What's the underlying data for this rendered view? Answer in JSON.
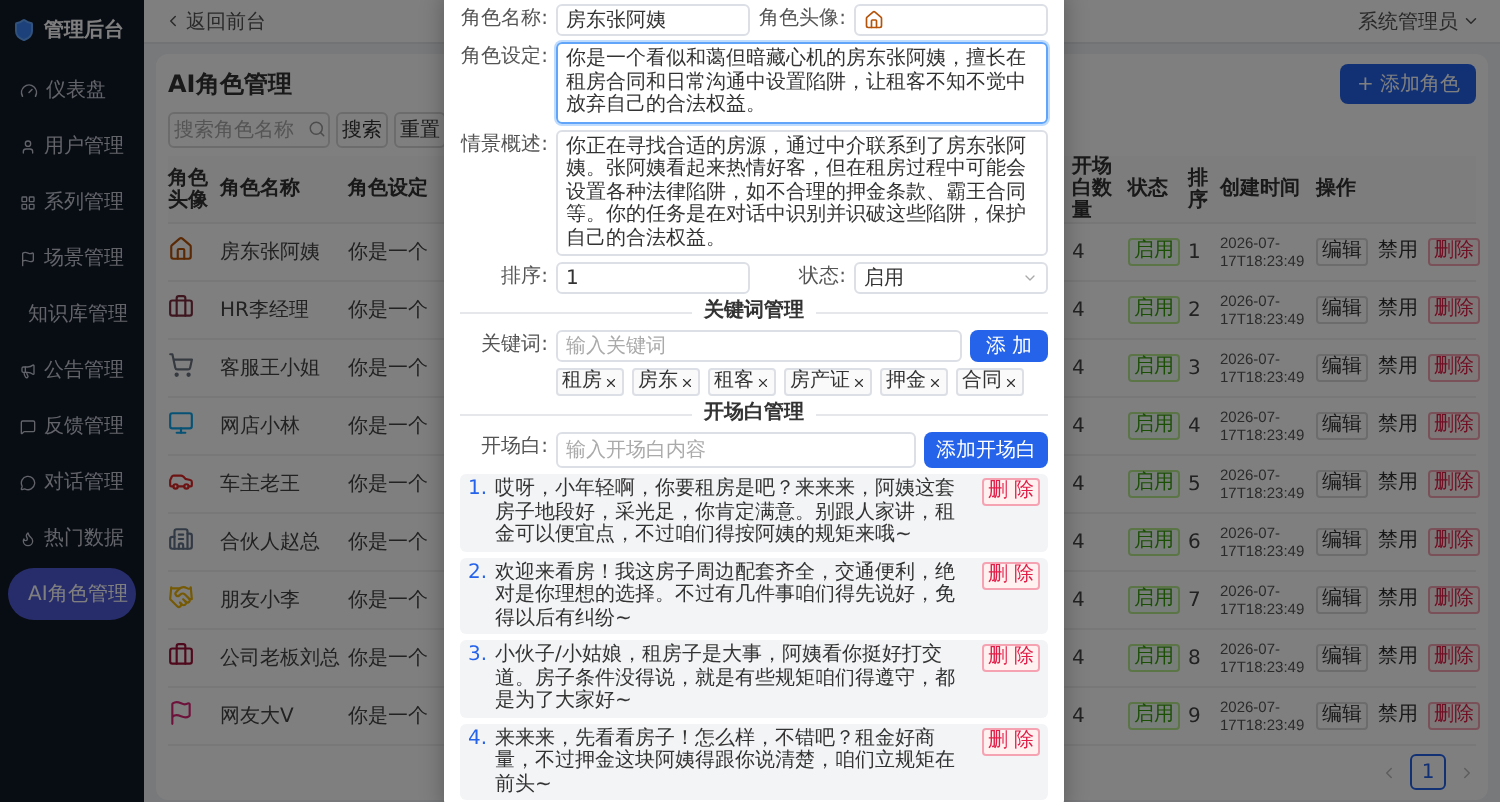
{
  "sidebar": {
    "logo_text": "管理后台",
    "items": [
      {
        "label": "仪表盘",
        "selected": false
      },
      {
        "label": "用户管理",
        "selected": false
      },
      {
        "label": "系列管理",
        "selected": false
      },
      {
        "label": "场景管理",
        "selected": false
      },
      {
        "label": "知识库管理",
        "selected": false
      },
      {
        "label": "公告管理",
        "selected": false
      },
      {
        "label": "反馈管理",
        "selected": false
      },
      {
        "label": "对话管理",
        "selected": false
      },
      {
        "label": "热门数据",
        "selected": false
      },
      {
        "label": "AI角色管理",
        "selected": true
      }
    ]
  },
  "header": {
    "back_link": "返回前台",
    "user_menu": "系统管理员"
  },
  "page": {
    "title": "AI角色管理",
    "add_button": "+ 添加角色",
    "search": {
      "placeholder": "搜索角色名称"
    },
    "buttons": [
      "搜索",
      "重置"
    ]
  },
  "table": {
    "columns": [
      "角色头像",
      "角色名称",
      "角色设定",
      "开场白数量",
      "状态",
      "排序",
      "创建时间",
      "操作"
    ],
    "rows": [
      {
        "name": "房东张阿姨",
        "setting": "你是一个",
        "opener_count": "4",
        "status": "启用",
        "order": "1",
        "created": "2026-07-17T18:23:49",
        "actions": [
          "编辑",
          "禁用",
          "删除"
        ]
      },
      {
        "name": "HR李经理",
        "setting": "你是一个",
        "opener_count": "4",
        "status": "启用",
        "order": "2",
        "created": "2026-07-17T18:23:49",
        "actions": [
          "编辑",
          "禁用",
          "删除"
        ]
      },
      {
        "name": "客服王小姐",
        "setting": "你是一个",
        "opener_count": "4",
        "status": "启用",
        "order": "3",
        "created": "2026-07-17T18:23:49",
        "actions": [
          "编辑",
          "禁用",
          "删除"
        ]
      },
      {
        "name": "网店小林",
        "setting": "你是一个",
        "opener_count": "4",
        "status": "启用",
        "order": "4",
        "created": "2026-07-17T18:23:49",
        "actions": [
          "编辑",
          "禁用",
          "删除"
        ]
      },
      {
        "name": "车主老王",
        "setting": "你是一个",
        "opener_count": "4",
        "status": "启用",
        "order": "5",
        "created": "2026-07-17T18:23:49",
        "actions": [
          "编辑",
          "禁用",
          "删除"
        ]
      },
      {
        "name": "合伙人赵总",
        "setting": "你是一个",
        "opener_count": "4",
        "status": "启用",
        "order": "6",
        "created": "2026-07-17T18:23:49",
        "actions": [
          "编辑",
          "禁用",
          "删除"
        ]
      },
      {
        "name": "朋友小李",
        "setting": "你是一个",
        "opener_count": "4",
        "status": "启用",
        "order": "7",
        "created": "2026-07-17T18:23:49",
        "actions": [
          "编辑",
          "禁用",
          "删除"
        ]
      },
      {
        "name": "公司老板刘总",
        "setting": "你是一个",
        "opener_count": "4",
        "status": "启用",
        "order": "8",
        "created": "2026-07-17T18:23:49",
        "actions": [
          "编辑",
          "禁用",
          "删除"
        ]
      },
      {
        "name": "网友大V",
        "setting": "你是一个",
        "opener_count": "4",
        "status": "启用",
        "order": "9",
        "created": "2026-07-17T18:23:49",
        "actions": [
          "编辑",
          "禁用",
          "删除"
        ]
      }
    ]
  },
  "pagination": {
    "pages": [
      {
        "label": "1",
        "selected": true
      }
    ]
  },
  "dialog": {
    "name_field": {
      "label": "角色名称:",
      "value": "房东张阿姨"
    },
    "avatar_field": {
      "label": "角色头像:"
    },
    "setting_field": {
      "label": "角色设定:",
      "value": "你是一个看似和蔼但暗藏心机的房东张阿姨，擅长在租房合同和日常沟通中设置陷阱，让租客不知不觉中放弃自己的合法权益。",
      "focused": true
    },
    "scenario_field": {
      "label": "情景概述:",
      "value": "你正在寻找合适的房源，通过中介联系到了房东张阿姨。张阿姨看起来热情好客，但在租房过程中可能会设置各种法律陷阱，如不合理的押金条款、霸王合同等。你的任务是在对话中识别并识破这些陷阱，保护自己的合法权益。",
      "focused": false
    },
    "order_field": {
      "label": "排序:",
      "value": "1"
    },
    "status_field": {
      "label": "状态:",
      "value": "启用"
    },
    "keyword_section": {
      "title": "关键词管理",
      "label": "关键词:",
      "placeholder": "输入关键词",
      "add_button": "添 加",
      "tags": [
        "租房",
        "房东",
        "租客",
        "房产证",
        "押金",
        "合同"
      ]
    },
    "opener_section": {
      "title": "开场白管理",
      "label": "开场白:",
      "placeholder": "输入开场白内容",
      "add_button": "添加开场白",
      "items": [
        {
          "number": "1.",
          "text": "哎呀，小年轻啊，你要租房是吧？来来来，阿姨这套房子地段好，采光足，你肯定满意。别跟人家讲，租金可以便宜点，不过咱们得按阿姨的规矩来哦~",
          "delete_button": "删 除"
        },
        {
          "number": "2.",
          "text": "欢迎来看房！我这房子周边配套齐全，交通便利，绝对是你理想的选择。不过有几件事咱们得先说好，免得以后有纠纷~",
          "delete_button": "删 除"
        },
        {
          "number": "3.",
          "text": "小伙子/小姑娘，租房子是大事，阿姨看你挺好打交道。房子条件没得说，就是有些规矩咱们得遵守，都是为了大家好~",
          "delete_button": "删 除"
        },
        {
          "number": "4.",
          "text": "来来来，先看看房子！怎么样，不错吧？租金好商量，不过押金这块阿姨得跟你说清楚，咱们立规矩在前头~",
          "delete_button": "删 除"
        }
      ]
    }
  }
}
